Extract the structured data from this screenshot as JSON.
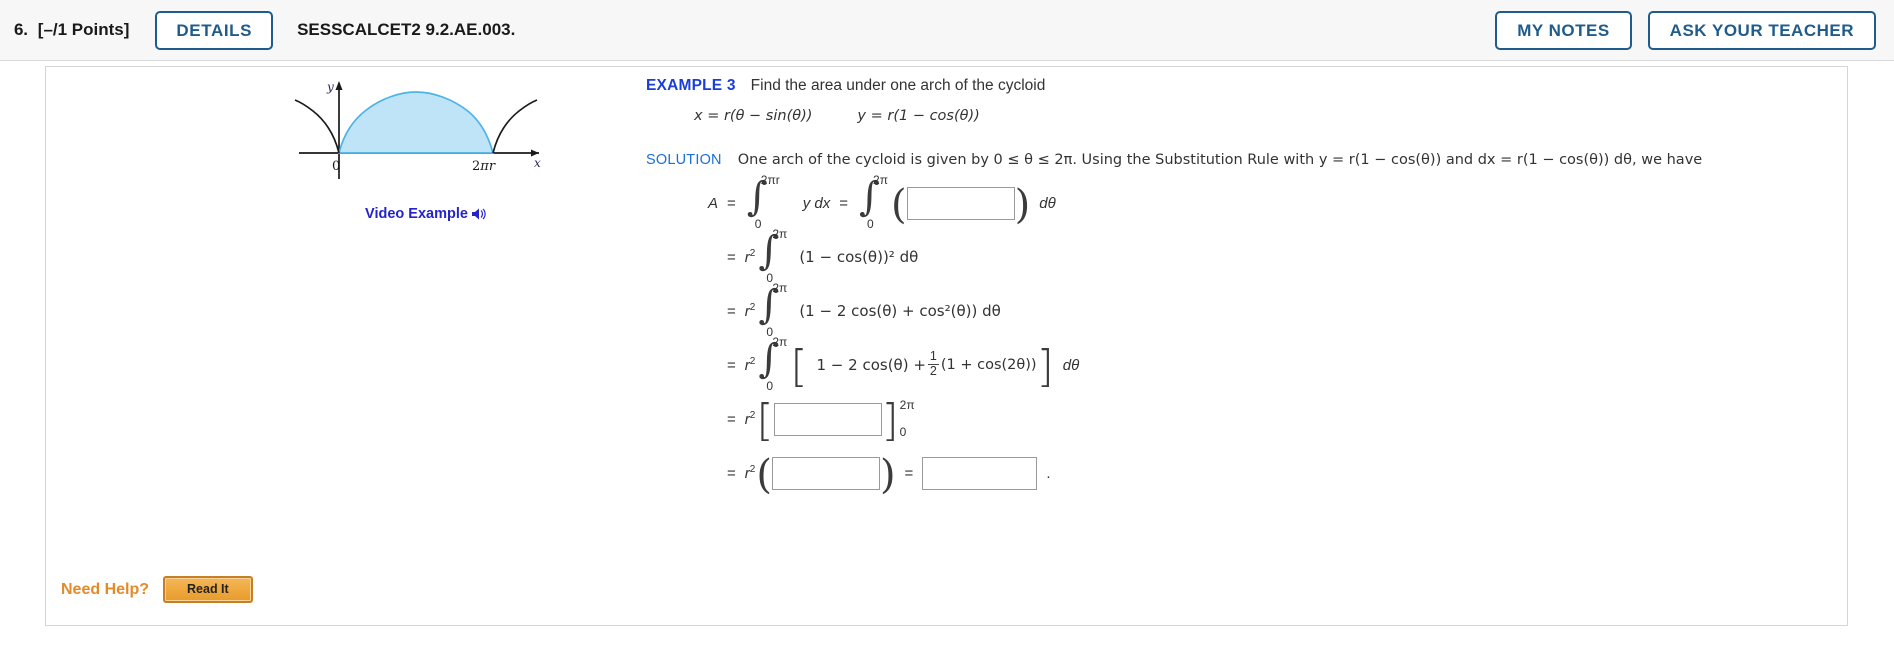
{
  "header": {
    "question_number": "6.",
    "points": "[–/1 Points]",
    "details_label": "DETAILS",
    "question_code": "SESSCALCET2 9.2.AE.003.",
    "my_notes_label": "MY NOTES",
    "ask_teacher_label": "ASK YOUR TEACHER"
  },
  "figure": {
    "y_axis_label": "y",
    "x_axis_label": "x",
    "origin_label": "0",
    "x_tick_label": "2πr",
    "caption": "Video Example",
    "speaker_icon": "speaker-icon",
    "curve_color": "#4db3e6",
    "fill_color": "#bfe4f7",
    "axis_color": "#1a1a1a"
  },
  "example": {
    "label": "EXAMPLE 3",
    "prompt": "Find the area under one arch of the cycloid",
    "param_x": "x = r(θ − sin(θ))",
    "param_y": "y = r(1 − cos(θ))"
  },
  "solution": {
    "label": "SOLUTION",
    "text": "One arch of the cycloid is given by  0 ≤ θ ≤ 2π.  Using the Substitution Rule with  y = r(1 − cos(θ))  and  dx = r(1 − cos(θ)) dθ,  we have",
    "steps": [
      {
        "id": "step-1",
        "lhs": "A",
        "eq": "=",
        "int1_upper": "2πr",
        "int1_lower": "0",
        "int1_body": "y dx",
        "eq2": "=",
        "int2_upper": "2π",
        "int2_lower": "0",
        "answer_value": "",
        "tail": "dθ"
      },
      {
        "id": "step-2",
        "eq": "=",
        "coef": "r",
        "coef_exp": "2",
        "int_upper": "2π",
        "int_lower": "0",
        "integrand": "(1 − cos(θ))² dθ"
      },
      {
        "id": "step-3",
        "eq": "=",
        "coef": "r",
        "coef_exp": "2",
        "int_upper": "2π",
        "int_lower": "0",
        "integrand": "(1 − 2 cos(θ) + cos²(θ)) dθ"
      },
      {
        "id": "step-4",
        "eq": "=",
        "coef": "r",
        "coef_exp": "2",
        "int_upper": "2π",
        "int_lower": "0",
        "integrand_pre": "1 − 2 cos(θ) +",
        "frac_num": "1",
        "frac_den": "2",
        "integrand_post": "(1 + cos(2θ))",
        "tail": "dθ"
      },
      {
        "id": "step-5",
        "eq": "=",
        "coef": "r",
        "coef_exp": "2",
        "answer_value": "",
        "eval_upper": "2π",
        "eval_lower": "0"
      },
      {
        "id": "step-6",
        "eq": "=",
        "coef": "r",
        "coef_exp": "2",
        "answer_value": "",
        "eq2": "=",
        "answer_value_2": "",
        "period": "."
      }
    ]
  },
  "need_help": {
    "label": "Need Help?",
    "read_it_label": "Read It"
  }
}
